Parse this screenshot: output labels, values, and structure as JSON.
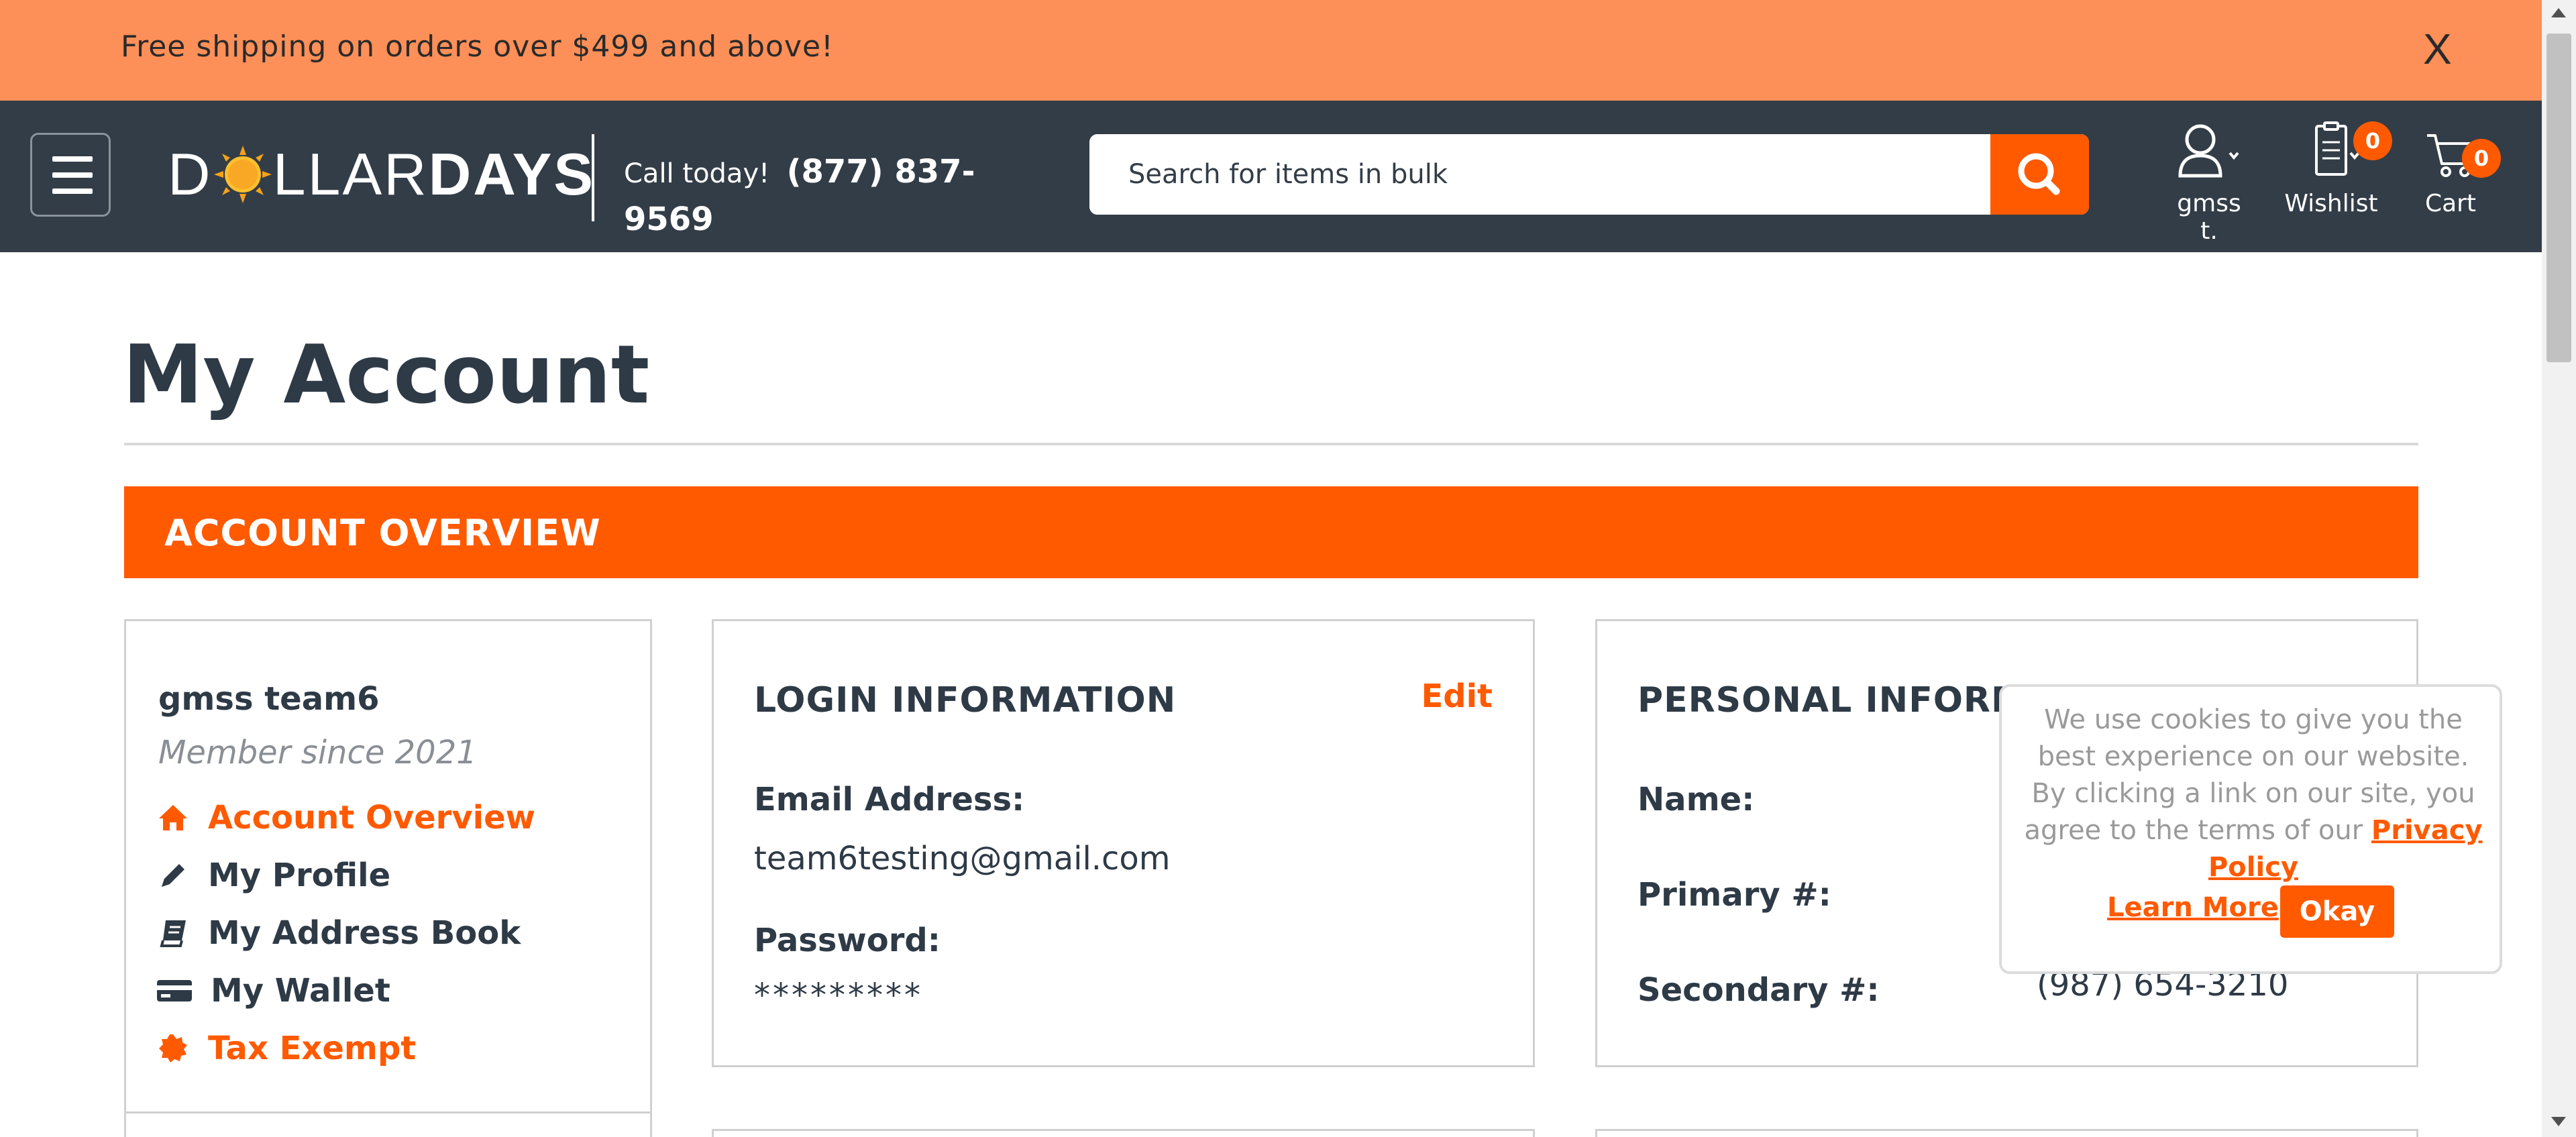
{
  "promo": {
    "text": "Free shipping on orders over $499 and above!",
    "close_label": "X"
  },
  "header": {
    "logo": {
      "part1": "D",
      "part2": "LLAR",
      "part3": "DAYS"
    },
    "call_label": "Call today!",
    "phone": "(877) 837-9569",
    "search_placeholder": "Search for items in bulk",
    "account_label": "gmss t.",
    "wishlist_label": "Wishlist",
    "wishlist_count": "0",
    "cart_label": "Cart",
    "cart_count": "0"
  },
  "page": {
    "title": "My Account",
    "overview_bar": "ACCOUNT OVERVIEW"
  },
  "sidebar": {
    "user_name": "gmss team6",
    "member_since": "Member since 2021",
    "items": [
      {
        "label": "Account Overview",
        "icon": "home-icon"
      },
      {
        "label": "My Profile",
        "icon": "pencil-icon"
      },
      {
        "label": "My Address Book",
        "icon": "book-icon"
      },
      {
        "label": "My Wallet",
        "icon": "credit-card-icon"
      },
      {
        "label": "Tax Exempt",
        "icon": "badge-icon"
      }
    ]
  },
  "login_info": {
    "heading": "LOGIN INFORMATION",
    "edit_label": "Edit",
    "email_label": "Email Address:",
    "email_value": "team6testing@gmail.com",
    "password_label": "Password:",
    "password_value": "*********"
  },
  "personal_info": {
    "heading": "PERSONAL INFORMA",
    "name_label": "Name:",
    "primary_label": "Primary #:",
    "secondary_label": "Secondary #:",
    "secondary_value": "(987) 654-3210"
  },
  "cookie": {
    "text": "We use cookies to give you the best experience on our website. By clicking a link on our site, you agree to the terms of our",
    "policy_link": "Privacy Policy",
    "learn_more": "Learn More",
    "okay": "Okay"
  },
  "colors": {
    "accent": "#ff5a00",
    "promo_bg": "#fd8f58",
    "header_bg": "#333d47",
    "text": "#2e3a46"
  }
}
